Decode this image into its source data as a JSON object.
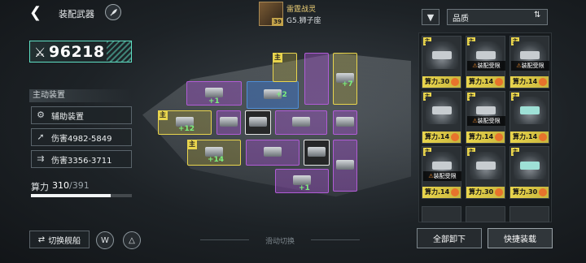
{
  "header": {
    "back_icon": "chevron-left-icon",
    "title": "装配武器",
    "feather_icon": "feather-icon"
  },
  "pilot": {
    "name": "雷霆战灵",
    "subtitle": "G5.狮子座",
    "level": "39"
  },
  "power": {
    "icon": "crossed-swords-icon",
    "value": "96218"
  },
  "stats": {
    "section_label": "主动装置",
    "rows": [
      {
        "icon": "gear-icon",
        "text": "辅助装置"
      },
      {
        "icon": "missile-icon",
        "text": "伤害4982-5849"
      },
      {
        "icon": "multi-missile-icon",
        "text": "伤害3356-3711"
      }
    ]
  },
  "compute": {
    "label": "算力",
    "used": "310",
    "max": "/391",
    "fraction": 0.793
  },
  "bottom_left": {
    "switch_ship_label": "切换舰船",
    "switch_ship_icon": "swap-icon",
    "round_btn_1_icon": "wings-icon",
    "round_btn_2_icon": "compass-icon"
  },
  "swipe_hint": "滑动切换",
  "ship_slots": {
    "main_tag": "主",
    "plus_values": [
      "+1",
      "+2",
      "+7",
      "+12",
      "+14",
      "+1"
    ]
  },
  "right_panel": {
    "filter_icon": "filter-icon",
    "sort_label": "品质",
    "sort_icon": "sort-icon",
    "corner_tag": "主",
    "warning_text": "装配受限",
    "cards": [
      {
        "cap": "算力.30",
        "warn": false
      },
      {
        "cap": "算力.14",
        "warn": true
      },
      {
        "cap": "算力.14",
        "warn": true
      },
      {
        "cap": "算力.14",
        "warn": false
      },
      {
        "cap": "算力.14",
        "warn": true
      },
      {
        "cap": "算力.14",
        "warn": false
      },
      {
        "cap": "算力.14",
        "warn": true
      },
      {
        "cap": "算力.30",
        "warn": false
      },
      {
        "cap": "算力.30",
        "warn": false
      }
    ],
    "unload_all_label": "全部卸下",
    "quick_equip_label": "快捷装载"
  },
  "colors": {
    "accent_teal": "#5fe0c4",
    "slot_purple": "#b15cd6",
    "slot_yellow": "#e9d54d",
    "slot_blue": "#4d8ed9",
    "plus_green": "#7cf07c"
  }
}
